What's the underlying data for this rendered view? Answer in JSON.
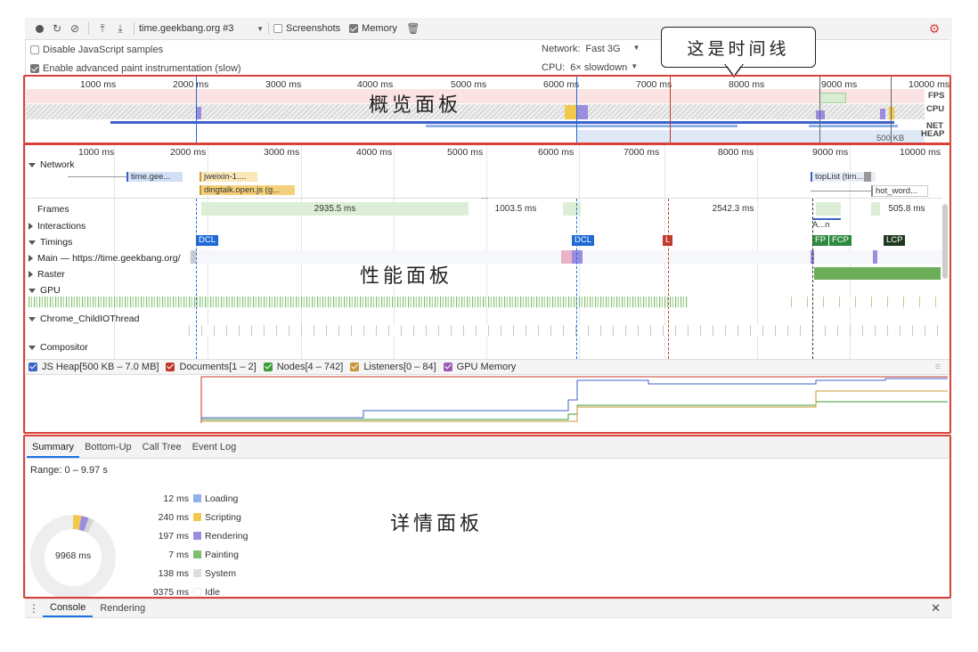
{
  "toolbar": {
    "url": "time.geekbang.org #3",
    "screenshots_label": "Screenshots",
    "memory_label": "Memory"
  },
  "settings": {
    "disable_js_samples": "Disable JavaScript samples",
    "advanced_paint": "Enable advanced paint instrumentation (slow)",
    "network_label": "Network:",
    "network_value": "Fast 3G",
    "cpu_label": "CPU:",
    "cpu_value": "6× slowdown"
  },
  "annotations": {
    "timeline": "这是时间线",
    "overview": "概览面板",
    "performance": "性能面板",
    "detail": "详情面板"
  },
  "overview": {
    "ticks": [
      "1000 ms",
      "2000 ms",
      "3000 ms",
      "4000 ms",
      "5000 ms",
      "6000 ms",
      "7000 ms",
      "8000 ms",
      "9000 ms",
      "10000 ms"
    ],
    "side_labels": [
      "FPS",
      "CPU",
      "NET",
      "HEAP"
    ],
    "heap_value": "500 KB"
  },
  "main": {
    "ticks": [
      "1000 ms",
      "2000 ms",
      "3000 ms",
      "4000 ms",
      "5000 ms",
      "6000 ms",
      "7000 ms",
      "8000 ms",
      "9000 ms",
      "10000 ms"
    ],
    "network_label": "Network",
    "net_requests": [
      "time.gee...",
      "jweixin-1....",
      "dingtalk.open.js (g...",
      "topList (tim...",
      "hot_word..."
    ],
    "tracks": {
      "frames": "Frames",
      "interactions": "Interactions",
      "timings": "Timings",
      "main": "Main — https://time.geekbang.org/",
      "raster": "Raster",
      "gpu": "GPU",
      "childio": "Chrome_ChildIOThread",
      "compositor": "Compositor"
    },
    "frames": [
      "2935.5 ms",
      "1003.5 ms",
      "2542.3 ms",
      "505.8 ms"
    ],
    "interaction_label": "A...n",
    "timings": [
      "DCL",
      "DCL",
      "L",
      "FP",
      "FCP",
      "LCP"
    ],
    "ellipsis": "...",
    "legend": [
      {
        "label": "JS Heap[500 KB – 7.0 MB]",
        "color": "#3d63c9"
      },
      {
        "label": "Documents[1 – 2]",
        "color": "#c0392b"
      },
      {
        "label": "Nodes[4 – 742]",
        "color": "#3a9d3a"
      },
      {
        "label": "Listeners[0 – 84]",
        "color": "#c9973a"
      },
      {
        "label": "GPU Memory",
        "color": "#9b59b6"
      }
    ]
  },
  "detail": {
    "tabs": [
      "Summary",
      "Bottom-Up",
      "Call Tree",
      "Event Log"
    ],
    "range": "Range: 0 – 9.97 s",
    "total": "9968 ms",
    "rows": [
      {
        "value": "12 ms",
        "label": "Loading",
        "color": "#8fb3e8"
      },
      {
        "value": "240 ms",
        "label": "Scripting",
        "color": "#f2c94c"
      },
      {
        "value": "197 ms",
        "label": "Rendering",
        "color": "#9b8ce0"
      },
      {
        "value": "7 ms",
        "label": "Painting",
        "color": "#7ebd6e"
      },
      {
        "value": "138 ms",
        "label": "System",
        "color": "#dddddd"
      },
      {
        "value": "9375 ms",
        "label": "Idle",
        "color": "#ffffff"
      }
    ]
  },
  "drawer": {
    "tabs": [
      "Console",
      "Rendering"
    ]
  },
  "colors": {
    "annotation_red": "#d8423a",
    "dcl_blue": "#1f6bd6",
    "load_red": "#c0392b",
    "fp_green": "#2e8b3e",
    "lcp_dark": "#1f3a1f",
    "scripting": "#f2c94c",
    "rendering": "#9b8ce0"
  }
}
